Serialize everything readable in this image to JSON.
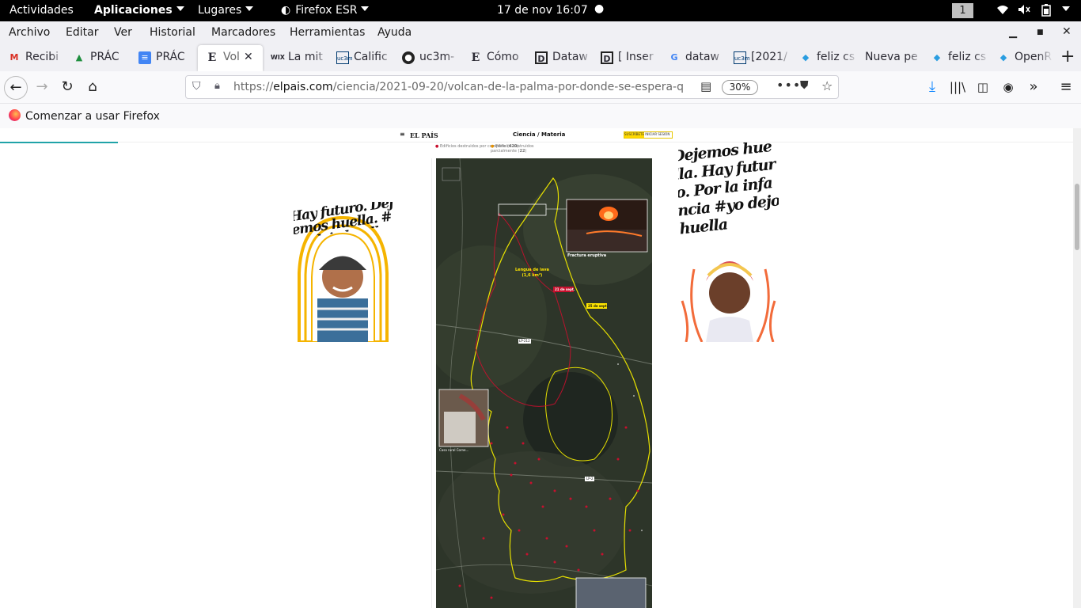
{
  "gnome": {
    "activities": "Actividades",
    "applications": "Aplicaciones",
    "places": "Lugares",
    "app": "Firefox ESR",
    "clock": "17 de nov  16:07",
    "workspace": "1"
  },
  "menu": [
    "Archivo",
    "Editar",
    "Ver",
    "Historial",
    "Marcadores",
    "Herramientas",
    "Ayuda"
  ],
  "tabs": [
    {
      "label": "Recibi",
      "icon": "gmail-icon"
    },
    {
      "label": "PRÁC",
      "icon": "drive-icon"
    },
    {
      "label": "PRÁC",
      "icon": "docs-icon"
    },
    {
      "label": "Vol",
      "icon": "elpais-icon"
    },
    {
      "label": "La mit",
      "icon": "wix-icon"
    },
    {
      "label": "Calific",
      "icon": "uc3m-icon"
    },
    {
      "label": "uc3m-",
      "icon": "github-icon"
    },
    {
      "label": "Cómo",
      "icon": "elpais-icon"
    },
    {
      "label": "Dataw",
      "icon": "datawrapper-icon"
    },
    {
      "label": "[ Inser",
      "icon": "datawrapper-icon"
    },
    {
      "label": "dataw",
      "icon": "google-icon"
    },
    {
      "label": "[2021/",
      "icon": "uc3m-icon"
    },
    {
      "label": "feliz cs",
      "icon": "gem-icon"
    },
    {
      "label": "Nueva pe",
      "icon": ""
    },
    {
      "label": "feliz cs",
      "icon": "gem-icon"
    },
    {
      "label": "OpenR",
      "icon": "gem-icon"
    }
  ],
  "url": {
    "prefix": "https://",
    "domain": "elpais.com",
    "path": "/ciencia/2021-09-20/volcan-de-la-palma-por-donde-se-espera-q",
    "zoom": "30%"
  },
  "bookmarks": {
    "getting_started": "Comenzar a usar Firefox"
  },
  "site": {
    "logo": "EL PAÍS",
    "section": "Ciencia",
    "subsection": "Materia",
    "subscribe": "SUSCRÍBETE",
    "login": "INICIAR SESIÓN"
  },
  "legend": {
    "destroyed": "Edificios destruidos por completo",
    "destroyed_count": "420",
    "partial": "Edificios destruidos parcialmente",
    "partial_count": "22"
  },
  "map_labels": {
    "fissure": "Fractura eruptiva",
    "lava_tongue": "Lengua de lava",
    "lava_area": "(1,6 km²)",
    "date_21": "21 de sept.",
    "date_25": "25 de sept.",
    "road_lp2": "LP-212",
    "road_lp2b": "LP-2",
    "house": "Casa rural Corne..."
  },
  "ads": {
    "left_text": "Hay futuro. Dejemos huella. #yo dejo huella",
    "right_text": "Dejemos huella. Hay futuro. Por la infancia #yo dejo huella"
  },
  "colors": {
    "lava_outline": "#e6e000",
    "lava_red": "#c8102e",
    "progress": "#20a3a8",
    "subscribe": "#ffd900"
  }
}
